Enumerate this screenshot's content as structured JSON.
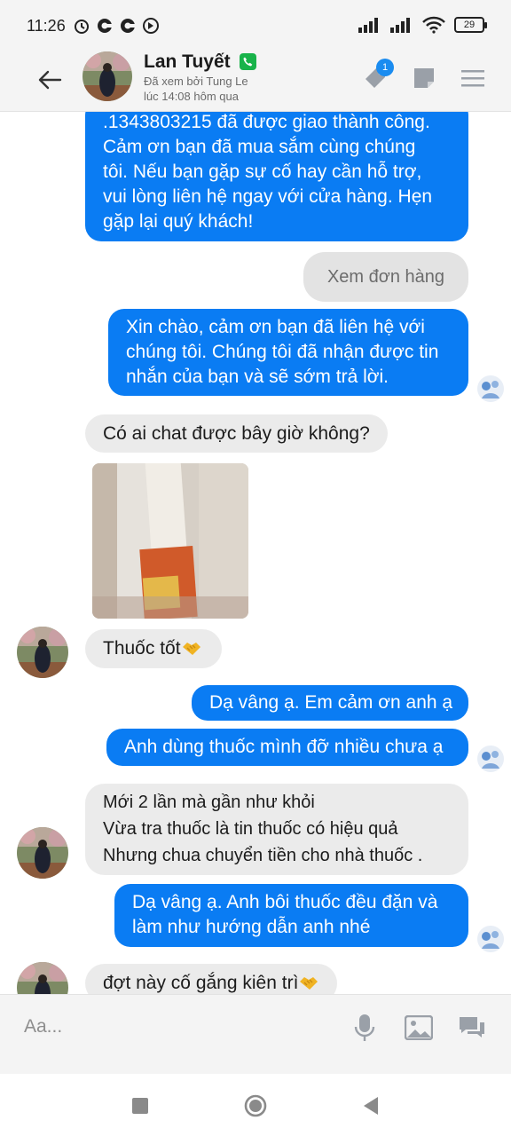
{
  "status_bar": {
    "time": "11:26",
    "battery": "29"
  },
  "header": {
    "contact_name": "Lan Tuyết",
    "seen_line1": "Đã xem bởi Tung Le",
    "seen_line2": "lúc 14:08 hôm qua",
    "notification_count": "1"
  },
  "messages": {
    "m1": {
      "lines": [
        ".1343803215 đã được giao thành công.",
        "Cảm ơn bạn đã mua sắm cùng chúng",
        "tôi. Nếu bạn gặp sự cố hay cần hỗ trợ,",
        "vui lòng liên hệ ngay với cửa hàng. Hẹn",
        "gặp lại quý khách!"
      ]
    },
    "view_order_button": "Xem đơn hàng",
    "m2": {
      "lines": [
        "Xin chào, cảm ơn bạn đã liên hệ với",
        "chúng tôi. Chúng tôi đã nhận được tin",
        "nhắn của bạn và sẽ sớm trả lời."
      ]
    },
    "m3": "Có ai chat được bây giờ không?",
    "m4": "Thuốc tốt",
    "m5": "Dạ vâng ạ. Em cảm ơn anh ạ",
    "m6": "Anh dùng thuốc mình đỡ nhiều chưa ạ",
    "m7": {
      "lines": [
        "Mới 2 lần mà gần như khỏi",
        "Vừa tra thuốc là tin thuốc có hiệu quả",
        "Nhưng chua chuyển tiền cho nhà thuốc ."
      ]
    },
    "m8": {
      "lines": [
        "Dạ vâng ạ. Anh bôi thuốc đều đặn và",
        "làm như hướng dẫn anh nhé"
      ]
    },
    "m9": "đợt này cố gắng kiên trì"
  },
  "input": {
    "placeholder": "Aa..."
  },
  "colors": {
    "outgoing_bubble": "#0a7cf3",
    "incoming_bubble": "#ebebeb",
    "accent": "#1a8cf0",
    "verified": "#18b34a"
  },
  "icons": {
    "back": "arrow-left-icon",
    "tag": "tag-icon",
    "note": "note-icon",
    "menu": "hamburger-menu-icon",
    "mic": "microphone-icon",
    "image": "image-icon",
    "chat": "chat-bubbles-icon",
    "nav_recent": "square-icon",
    "nav_home": "circle-icon",
    "nav_back": "triangle-back-icon",
    "emoji": "handshake-emoji"
  }
}
